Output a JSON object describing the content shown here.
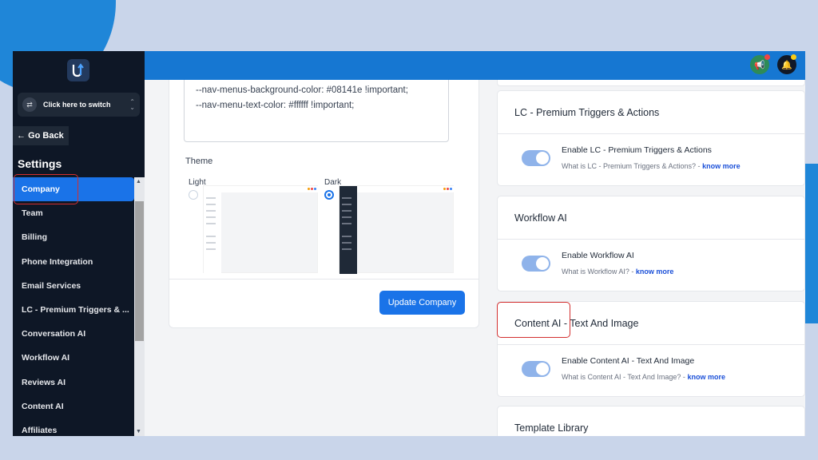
{
  "sidebar": {
    "switcher_label": "Click here to switch",
    "go_back": "Go Back",
    "settings_title": "Settings",
    "items": [
      {
        "label": "Company",
        "active": true
      },
      {
        "label": "Team"
      },
      {
        "label": "Billing"
      },
      {
        "label": "Phone Integration"
      },
      {
        "label": "Email Services"
      },
      {
        "label": "LC - Premium Triggers & ..."
      },
      {
        "label": "Conversation AI"
      },
      {
        "label": "Workflow AI"
      },
      {
        "label": "Reviews AI"
      },
      {
        "label": "Content AI"
      },
      {
        "label": "Affiliates"
      }
    ]
  },
  "company": {
    "css_lines": [
      "--nav-menus-background-color: #08141e !important;",
      "--nav-menu-text-color: #ffffff !important;"
    ],
    "theme_title": "Theme",
    "theme_light": "Light",
    "theme_dark": "Dark",
    "update_button": "Update Company"
  },
  "cards": [
    {
      "header": "LC - Premium Triggers & Actions",
      "toggle_label": "Enable LC - Premium Triggers & Actions",
      "help_text": "What is LC - Premium Triggers & Actions? -",
      "link": "know more"
    },
    {
      "header": "Workflow AI",
      "toggle_label": "Enable Workflow AI",
      "help_text": "What is Workflow AI? -",
      "link": "know more"
    },
    {
      "header": "Content AI - Text And Image",
      "toggle_label": "Enable Content AI - Text And Image",
      "help_text": "What is Content AI - Text And Image? -",
      "link": "know more"
    },
    {
      "header": "Template Library"
    }
  ],
  "colors": {
    "primary": "#1a73e8",
    "topbar": "#1677d2",
    "sidebar_bg": "#0e1726",
    "highlight": "#d32f2f"
  }
}
